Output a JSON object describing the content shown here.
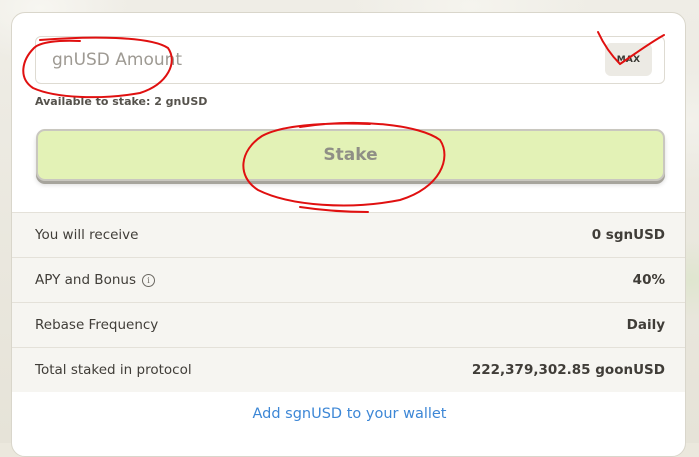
{
  "stake_form": {
    "amount_placeholder": "gnUSD Amount",
    "max_label": "MAX",
    "available_text": "Available to stake: 2 gnUSD",
    "stake_label": "Stake"
  },
  "info_rows": [
    {
      "label": "You will receive",
      "value": "0 sgnUSD"
    },
    {
      "label": "APY and Bonus",
      "info_icon": "i",
      "value": "40%"
    },
    {
      "label": "Rebase Frequency",
      "value": "Daily"
    },
    {
      "label": "Total staked in protocol",
      "value": "222,379,302.85 goonUSD"
    }
  ],
  "add_wallet_link": "Add sgnUSD to your wallet",
  "annotation_color": "#e01010"
}
